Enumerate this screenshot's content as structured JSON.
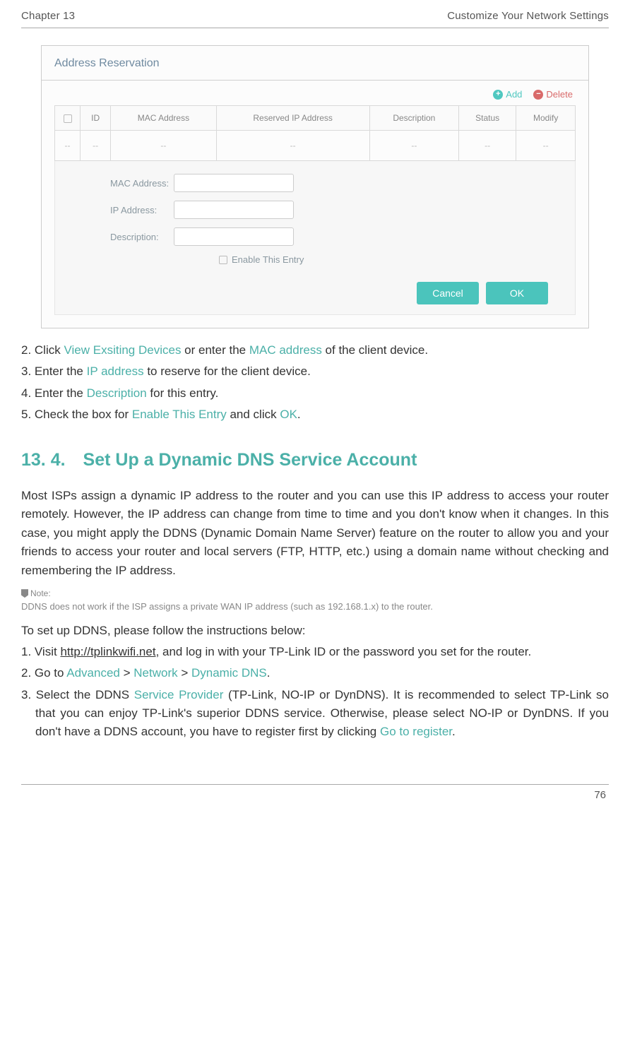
{
  "header": {
    "chapter": "Chapter 13",
    "title": "Customize Your Network Settings"
  },
  "panel": {
    "title": "Address Reservation",
    "actions": {
      "add": "Add",
      "delete": "Delete"
    },
    "table": {
      "headers": [
        "ID",
        "MAC Address",
        "Reserved IP Address",
        "Description",
        "Status",
        "Modify"
      ],
      "row": [
        "--",
        "--",
        "--",
        "--",
        "--",
        "--",
        "--"
      ]
    },
    "form": {
      "mac_label": "MAC Address:",
      "ip_label": "IP Address:",
      "desc_label": "Description:",
      "enable_label": "Enable This Entry",
      "cancel": "Cancel",
      "ok": "OK"
    }
  },
  "narrative": {
    "step2_a": "2. Click ",
    "step2_view": "View Exsiting Devices",
    "step2_b": " or enter the ",
    "step2_mac": "MAC address",
    "step2_c": " of the client device.",
    "step3_a": "3. Enter the ",
    "step3_ip": "IP address",
    "step3_b": " to reserve for the client device.",
    "step4_a": "4. Enter the ",
    "step4_desc": "Description",
    "step4_b": " for this entry.",
    "step5_a": "5. Check the box for ",
    "step5_en": "Enable This Entry",
    "step5_b": " and click ",
    "step5_ok": "OK",
    "step5_c": "."
  },
  "section": {
    "heading": "13. 4. Set Up a Dynamic DNS Service Account",
    "intro": "Most ISPs assign a dynamic IP address to the router and you can use this IP address to access your router remotely. However, the IP address can change from time to time and you don't know when it changes. In this case, you might apply the DDNS (Dynamic Domain Name Server) feature on the router to allow you and your friends to access your router and local servers (FTP, HTTP, etc.) using a domain name without checking and remembering the IP address.",
    "note_label": "Note:",
    "note_text": "DDNS does not work if the ISP assigns a private WAN IP address (such as 192.168.1.x) to the router.",
    "setup_intro": "To set up DDNS, please follow the instructions below:",
    "s1_a": "1. Visit ",
    "s1_link": "http://tplinkwifi.net",
    "s1_b": ", and log in with your TP-Link ID or the password you set for the router.",
    "s2_a": "2. Go to ",
    "s2_adv": "Advanced",
    "s2_g1": " > ",
    "s2_net": "Network",
    "s2_g2": " > ",
    "s2_ddns": "Dynamic DNS",
    "s2_c": ".",
    "s3_a": "3. Select the DDNS ",
    "s3_sp": "Service Provider",
    "s3_b": " (TP-Link, NO-IP or DynDNS). It is recommended to select TP-Link so that you can enjoy TP-Link's superior DDNS service. Otherwise, please select NO-IP or DynDNS. If you don't have a DDNS account, you have to register first by clicking ",
    "s3_reg": "Go to register",
    "s3_c": "."
  },
  "footer": {
    "page": "76"
  }
}
